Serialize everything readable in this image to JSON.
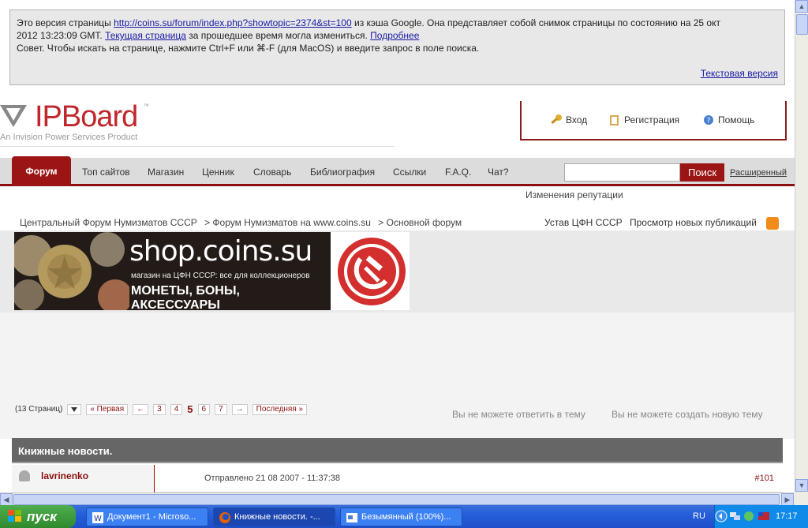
{
  "cache": {
    "line1_pre": "Это версия страницы ",
    "url": "http://coins.su/forum/index.php?showtopic=2374&st=100",
    "line1_post": " из кэша Google. Она представляет собой снимок страницы по состоянию на 25 окт",
    "line2_pre": "2012 13:23:09 GMT. ",
    "current_page": "Текущая страница",
    "line2_mid": " за прошедшее время могла измениться. ",
    "more": "Подробнее",
    "line3": "Совет. Чтобы искать на странице, нажмите Ctrl+F или ⌘-F (для MacOS) и введите запрос в поле поиска.",
    "text_version": "Текстовая версия"
  },
  "header": {
    "logo_name": "IPBoard",
    "logo_tm": "™",
    "logo_sub": "An Invision Power Services Product",
    "login": "Вход",
    "register": "Регистрация",
    "help": "Помощь"
  },
  "nav": {
    "active": "Форум",
    "items": [
      "Топ сайтов",
      "Магазин",
      "Ценник",
      "Словарь",
      "Библиография",
      "Ссылки",
      "F.A.Q.",
      "Чат?"
    ],
    "search_button": "Поиск",
    "advanced": "Расширенный",
    "reputation": "Изменения репутации"
  },
  "breadcrumb": {
    "items": [
      "Центральный Форум Нумизматов СССР",
      "> Форум Нумизматов на www.coins.su",
      "> Основной форум"
    ],
    "rules": "Устав ЦФН СССР",
    "new_posts": "Просмотр новых публикаций"
  },
  "banner": {
    "title": "shop.coins.su",
    "subtitle": "магазин на ЦФН СССР: все для коллекционеров",
    "big": "МОНЕТЫ, БОНЫ, АКСЕССУАРЫ"
  },
  "pagination": {
    "pages_label": "(13 Страниц)",
    "first": "« Первая",
    "prev": "←",
    "pages": [
      "3",
      "4"
    ],
    "current": "5",
    "after": [
      "6",
      "7"
    ],
    "next": "→",
    "last": "Последняя »",
    "no_reply": "Вы не можете ответить в тему",
    "no_new": "Вы не можете создать новую тему"
  },
  "topic": {
    "title": "Книжные новости.",
    "poster": "lavrinenko",
    "sent": "Отправлено 21 08 2007 - 11:37:38",
    "post_number": "#101"
  },
  "taskbar": {
    "start": "пуск",
    "windows": [
      "Документ1 - Microso...",
      "Книжные новости. -...",
      "Безымянный (100%)..."
    ],
    "lang": "RU",
    "clock": "17:17"
  },
  "colors": {
    "accent": "#9b1515",
    "cache_link": "#1a1aa6",
    "taskbar": "#245edb"
  }
}
